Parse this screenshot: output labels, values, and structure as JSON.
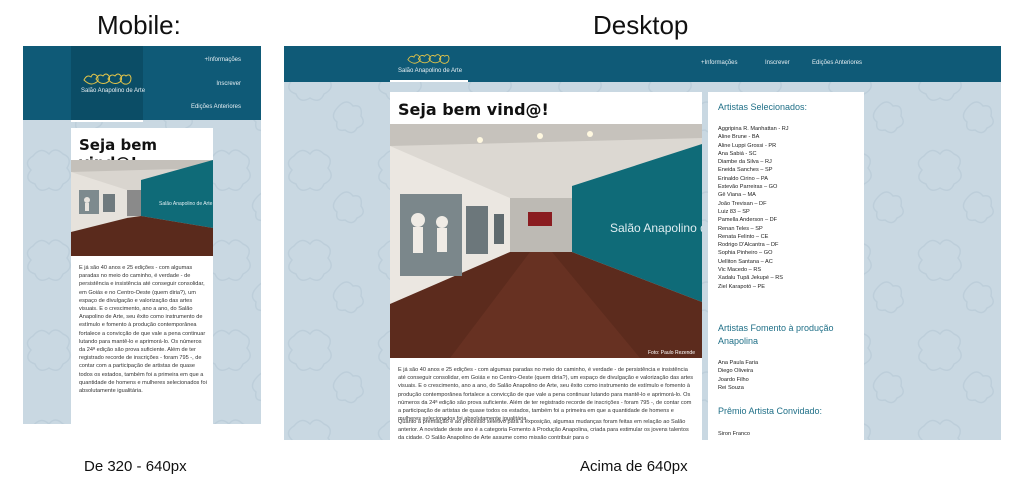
{
  "labels": {
    "mobile": "Mobile:",
    "desktop": "Desktop",
    "mobile_range": "De 320 - 640px",
    "desktop_range": "Acima de 640px"
  },
  "site": {
    "logo_text": "Salão Anapolino de Arte",
    "nav": [
      "+Informações",
      "Inscrever",
      "Edições Anteriores"
    ]
  },
  "welcome_title": "Seja bem vind@!",
  "photo_credit": "Foto: Paulo Rezende",
  "photo_wall_text": "Salão Anapolino de Arte",
  "mobile_paragraph": "E já são 40 anos e 25 edições - com algumas paradas no meio do caminho, é verdade - de persistência e insistência até conseguir consolidar, em Goiás e no Centro-Oeste (quem diria?), um espaço de divulgação e valorização das artes visuais. E o crescimento, ano a ano, do Salão Anapolino de Arte, seu êxito como instrumento de estímulo e fomento à produção contemporânea fortalece a convicção de que vale a pena continuar lutando para mantê-lo e aprimorá-lo. Os números da 24ª edição são prova suficiente. Além de ter registrado recorde de inscrições - foram 795 -, de contar com a participação de artistas de quase todos os estados, também foi a primeira em que a quantidade de homens e mulheres selecionados foi absolutamente igualitária.",
  "desktop_paragraph1": "E já são 40 anos e 25 edições - com algumas paradas no meio do caminho, é verdade - de persistência e insistência até conseguir consolidar, em Goiás e no Centro-Oeste (quem diria?), um espaço de divulgação e valorização das artes visuais. E o crescimento, ano a ano, do Salão Anapolino de Arte, seu êxito como instrumento de estímulo e fomento à produção contemporânea fortalece a convicção de que vale a pena continuar lutando para mantê-lo e aprimorá-lo. Os números da 24ª edição são prova suficiente. Além de ter registrado recorde de inscrições - foram 795 -, de contar com a participação de artistas de quase todos os estados, também foi a primeira em que a quantidade de homens e mulheres selecionados foi absolutamente igualitária.",
  "desktop_paragraph2": "Quanto à premiação e ao processo seletivo para a exposição, algumas mudanças foram feitas em relação ao Salão anterior. A novidade deste ano é a categoria Fomento à Produção Anapolina, criada para estimular os jovens talentos da cidade. O Salão Anapolino de Arte assume como missão contribuir para o",
  "sidebar": {
    "selected_title": "Artistas Selecionados:",
    "selected": [
      "Aggripina R. Manhattan - RJ",
      "Aline Brune - BA",
      "Aline Luppi Grossi - PR",
      "Ana Sabiá - SC",
      "Diambe da Silva – RJ",
      "Eneida Sanches – SP",
      "Erinaldo Cirino – PA",
      "Estevão Parreiras – GO",
      "Gê Viana – MA",
      "João Trevisan – DF",
      "Luiz 83 – SP",
      "Pamella Anderson – DF",
      "Renan Teles – SP",
      "Renata Felinto – CE",
      "Rodrigo D'Alcantra – DF",
      "Sophia Pinheiro – GO",
      "Uelliton Santana – AC",
      "Vic Macedo – RS",
      "Xadalu Tupã Jekupé – RS",
      "Ziel Karapotó – PE"
    ],
    "fomento_title": "Artistas Fomento à produção Anapolina",
    "fomento": [
      "Ana Paula Faria",
      "Diego Oliveira",
      "Joardo Filho",
      "Rei Souza"
    ],
    "invited_title": "Prêmio Artista Convidado:",
    "invited": [
      "Siron Franco"
    ]
  },
  "colors": {
    "header": "#0f5a77",
    "logo_box": "#0b4d66",
    "background": "#c9d8e2",
    "accent": "#1f6f87"
  }
}
